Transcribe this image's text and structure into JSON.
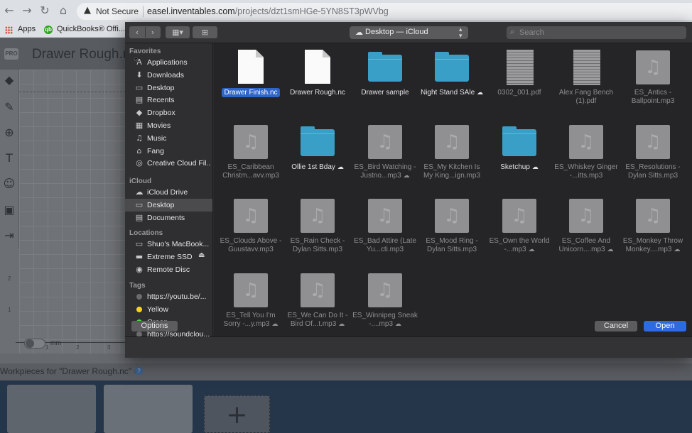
{
  "browser": {
    "back": "←",
    "forward": "→",
    "reload": "↻",
    "home": "⌂",
    "security_label": "Not Secure",
    "url_host": "easel.inventables.com",
    "url_path": "/projects/dzt1smHGe-5YN8ST3pWVbg",
    "bookmarks": [
      {
        "label": "Apps"
      },
      {
        "label": "QuickBooks® Offi..."
      }
    ]
  },
  "app": {
    "pro_badge": "PRO",
    "project_title": "Drawer Rough.nc",
    "ruler_numbers": [
      "2",
      "1"
    ],
    "x_axis_numbers": [
      "1",
      "2",
      "3"
    ],
    "unit_label": "mm",
    "workpieces_label": "Workpieces for \"Drawer Rough.nc\" ",
    "help": "?",
    "add_symbol": "+"
  },
  "dialog": {
    "location": "Desktop — iCloud",
    "search_placeholder": "Search",
    "sidebar": {
      "sections": [
        {
          "title": "Favorites",
          "items": [
            {
              "label": "Applications",
              "icon": "A"
            },
            {
              "label": "Downloads",
              "icon": "⬇"
            },
            {
              "label": "Desktop",
              "icon": "▭"
            },
            {
              "label": "Recents",
              "icon": "▤"
            },
            {
              "label": "Dropbox",
              "icon": "◆"
            },
            {
              "label": "Movies",
              "icon": "▦"
            },
            {
              "label": "Music",
              "icon": "♫"
            },
            {
              "label": "Fang",
              "icon": "⌂"
            },
            {
              "label": "Creative Cloud Fil...",
              "icon": "◎"
            }
          ]
        },
        {
          "title": "iCloud",
          "items": [
            {
              "label": "iCloud Drive",
              "icon": "☁"
            },
            {
              "label": "Desktop",
              "icon": "▭",
              "selected": true
            },
            {
              "label": "Documents",
              "icon": "▤"
            }
          ]
        },
        {
          "title": "Locations",
          "items": [
            {
              "label": "Shuo's MacBook...",
              "icon": "▭"
            },
            {
              "label": "Extreme SSD",
              "icon": "▬",
              "eject": "⏏"
            },
            {
              "label": "Remote Disc",
              "icon": "◉"
            }
          ]
        },
        {
          "title": "Tags",
          "items": [
            {
              "label": "https://youtu.be/...",
              "dot": "#6b6b6e"
            },
            {
              "label": "Yellow",
              "dot": "#f5d31c"
            },
            {
              "label": "Green",
              "dot": "#4fd34a"
            },
            {
              "label": "https://soundclou...",
              "dot": "#6b6b6e"
            }
          ]
        }
      ]
    },
    "files": [
      {
        "kind": "doc",
        "name": "Drawer Finish.nc",
        "selected": true
      },
      {
        "kind": "doc",
        "name": "Drawer Rough.nc"
      },
      {
        "kind": "folder",
        "name": "Drawer sample"
      },
      {
        "kind": "folder",
        "name": "Night Stand SAle",
        "cloud": true
      },
      {
        "kind": "pdf",
        "name": "0302_001.pdf",
        "dim": true
      },
      {
        "kind": "pdf",
        "name": "Alex Fang Bench (1).pdf",
        "dim": true
      },
      {
        "kind": "audio",
        "name": "ES_Antics - Ballpoint.mp3",
        "dim": true
      },
      {
        "kind": "audio",
        "name": "ES_Caribbean Christm...avv.mp3",
        "dim": true
      },
      {
        "kind": "folder",
        "name": "Ollie 1st Bday",
        "cloud": true
      },
      {
        "kind": "audio",
        "name": "ES_Bird Watching - Justno...mp3",
        "cloud": true,
        "dim": true
      },
      {
        "kind": "audio",
        "name": "ES_My Kitchen Is My King...ign.mp3",
        "dim": true
      },
      {
        "kind": "folder",
        "name": "Sketchup",
        "cloud": true
      },
      {
        "kind": "audio",
        "name": "ES_Whiskey Ginger -...itts.mp3",
        "dim": true
      },
      {
        "kind": "audio",
        "name": "ES_Resolutions - Dylan Sitts.mp3",
        "dim": true
      },
      {
        "kind": "audio",
        "name": "ES_Clouds Above - Guustavv.mp3",
        "dim": true
      },
      {
        "kind": "audio",
        "name": "ES_Rain Check - Dylan Sitts.mp3",
        "dim": true
      },
      {
        "kind": "audio",
        "name": "ES_Bad Attire (Late Yu...cti.mp3",
        "dim": true
      },
      {
        "kind": "audio",
        "name": "ES_Mood Ring - Dylan Sitts.mp3",
        "dim": true
      },
      {
        "kind": "audio",
        "name": "ES_Own the World -...mp3",
        "cloud": true,
        "dim": true
      },
      {
        "kind": "audio",
        "name": "ES_Coffee And Unicorn....mp3",
        "cloud": true,
        "dim": true
      },
      {
        "kind": "audio",
        "name": "ES_Monkey Throw Monkey....mp3",
        "cloud": true,
        "dim": true
      },
      {
        "kind": "audio",
        "name": "ES_Tell You I'm Sorry -...y.mp3",
        "cloud": true,
        "dim": true
      },
      {
        "kind": "audio",
        "name": "ES_We Can Do It - Bird Of...t.mp3",
        "cloud": true,
        "dim": true
      },
      {
        "kind": "audio",
        "name": "ES_Winnipeg Sneak -....mp3",
        "cloud": true,
        "dim": true
      }
    ],
    "options_label": "Options",
    "cancel_label": "Cancel",
    "open_label": "Open",
    "accent_color": "#2e6ae0",
    "folder_color": "#3a9fc6"
  }
}
